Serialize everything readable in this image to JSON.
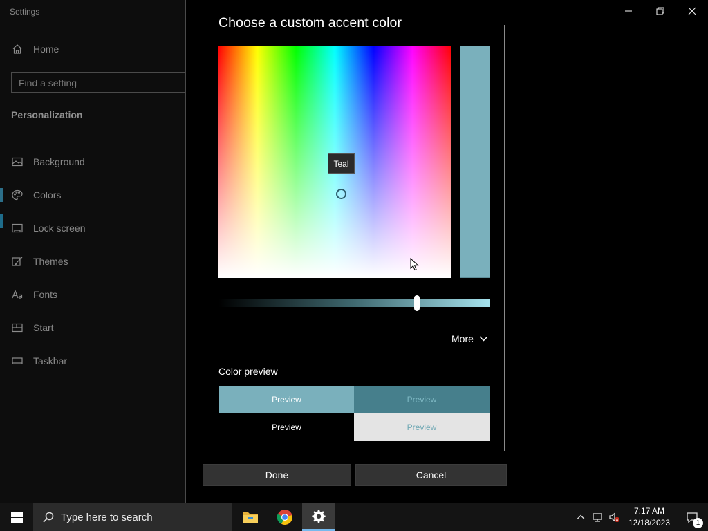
{
  "settings": {
    "window_title": "Settings",
    "home_label": "Home",
    "search_placeholder": "Find a setting",
    "section_title": "Personalization",
    "nav_items": [
      {
        "label": "Background",
        "icon": "image-icon"
      },
      {
        "label": "Colors",
        "icon": "palette-icon",
        "selected": true
      },
      {
        "label": "Lock screen",
        "icon": "lock-screen-icon"
      },
      {
        "label": "Themes",
        "icon": "brush-icon"
      },
      {
        "label": "Fonts",
        "icon": "font-icon"
      },
      {
        "label": "Start",
        "icon": "start-icon"
      },
      {
        "label": "Taskbar",
        "icon": "taskbar-icon"
      }
    ]
  },
  "dialog": {
    "title": "Choose a custom accent color",
    "tooltip": "Teal",
    "selected_color": "#7ab0bc",
    "brightness_level_percent": 72,
    "more_label": "More",
    "color_preview_label": "Color preview",
    "previews": [
      "Preview",
      "Preview",
      "Preview",
      "Preview"
    ],
    "done_label": "Done",
    "cancel_label": "Cancel"
  },
  "taskbar": {
    "search_placeholder": "Type here to search",
    "apps": [
      "file-explorer-icon",
      "chrome-icon",
      "settings-gear-icon"
    ],
    "time": "7:17 AM",
    "date": "12/18/2023",
    "notification_count": "1"
  }
}
